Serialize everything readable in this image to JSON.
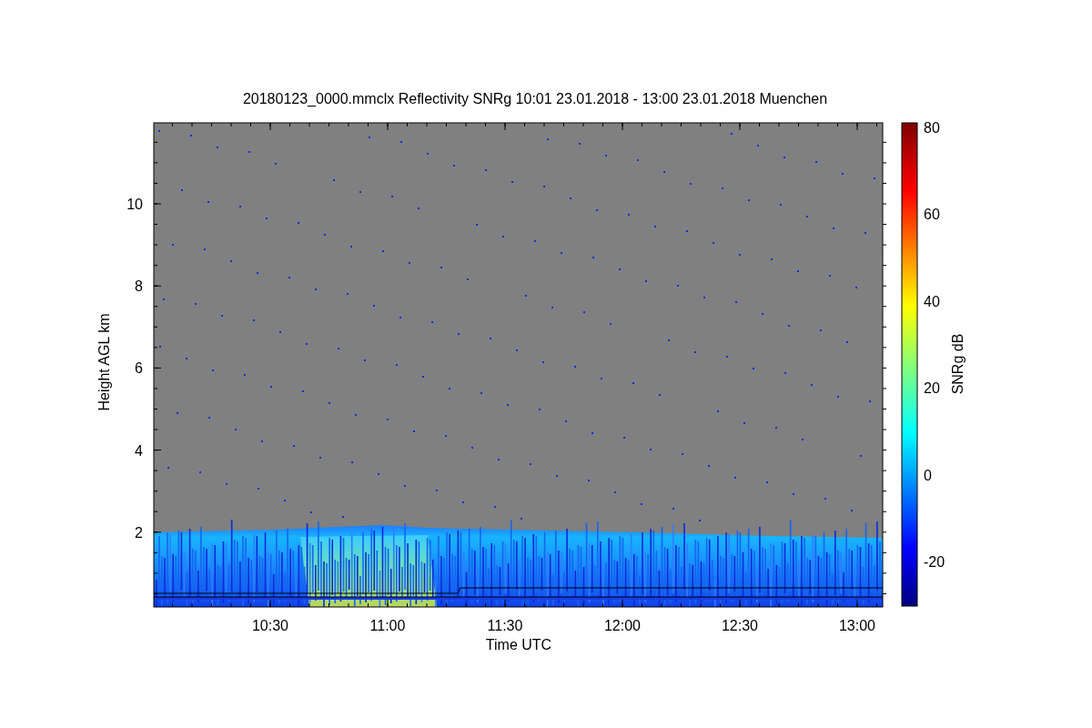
{
  "title": "20180123_0000.mmclx Reflectivity SNRg   10:01 23.01.2018 - 13:00 23.01.2018 Muenchen",
  "y_axis": {
    "label": "Height AGL km",
    "ticks": [
      "10",
      "8",
      "6",
      "4",
      "2"
    ]
  },
  "x_axis": {
    "label": "Time UTC",
    "ticks": [
      "10:30",
      "11:00",
      "11:30",
      "12:00",
      "12:30",
      "13:00"
    ]
  },
  "colorbar": {
    "label": "SNRg dB",
    "ticks": [
      "80",
      "60",
      "40",
      "20",
      "0",
      "-20"
    ]
  }
}
